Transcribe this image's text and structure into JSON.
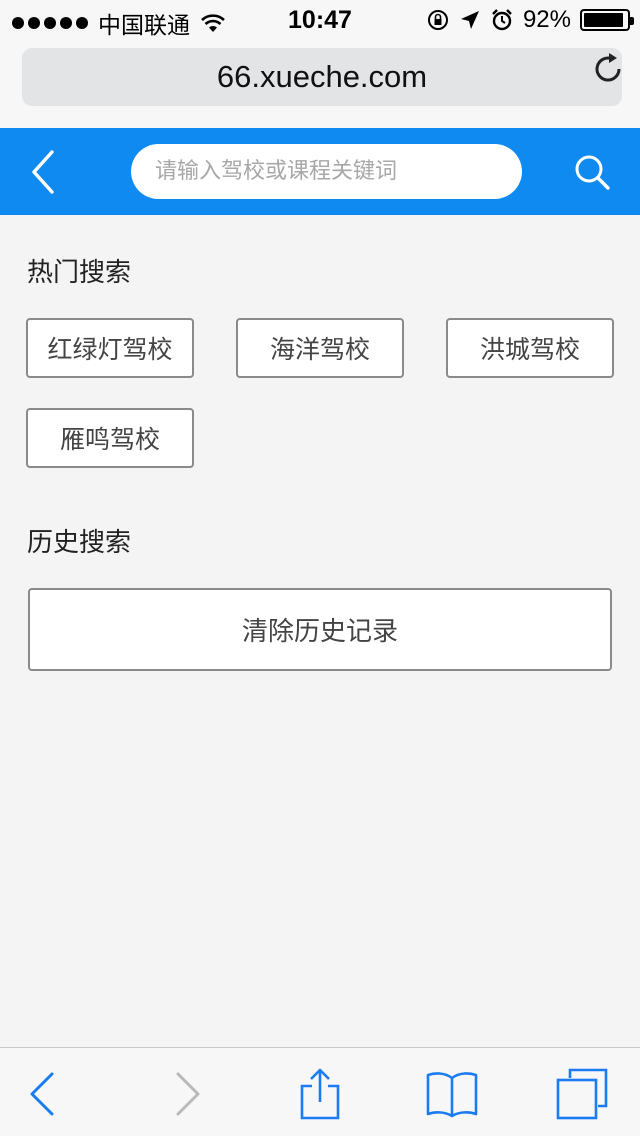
{
  "status_bar": {
    "carrier": "中国联通",
    "time": "10:47",
    "battery_percent": "92%",
    "battery_level": 0.92,
    "icons": [
      "signal-dots",
      "wifi-icon",
      "rotation-lock-icon",
      "location-arrow-icon",
      "alarm-icon",
      "battery-icon"
    ]
  },
  "browser": {
    "url": "66.xueche.com",
    "reload_icon": "reload-icon"
  },
  "header": {
    "back_icon": "chevron-left-icon",
    "search_placeholder": "请输入驾校或课程关键词",
    "search_value": "",
    "search_icon": "search-icon",
    "background_color": "#0f8af0"
  },
  "hot_search": {
    "title": "热门搜索",
    "tags": [
      "红绿灯驾校",
      "海洋驾校",
      "洪城驾校",
      "雁鸣驾校"
    ]
  },
  "history_search": {
    "title": "历史搜索",
    "clear_label": "清除历史记录"
  },
  "toolbar": {
    "icons": [
      "back-icon",
      "forward-icon",
      "share-icon",
      "bookmarks-icon",
      "tabs-icon"
    ],
    "accent_color": "#1a7cf0",
    "disabled_color": "#b9b9b9"
  }
}
